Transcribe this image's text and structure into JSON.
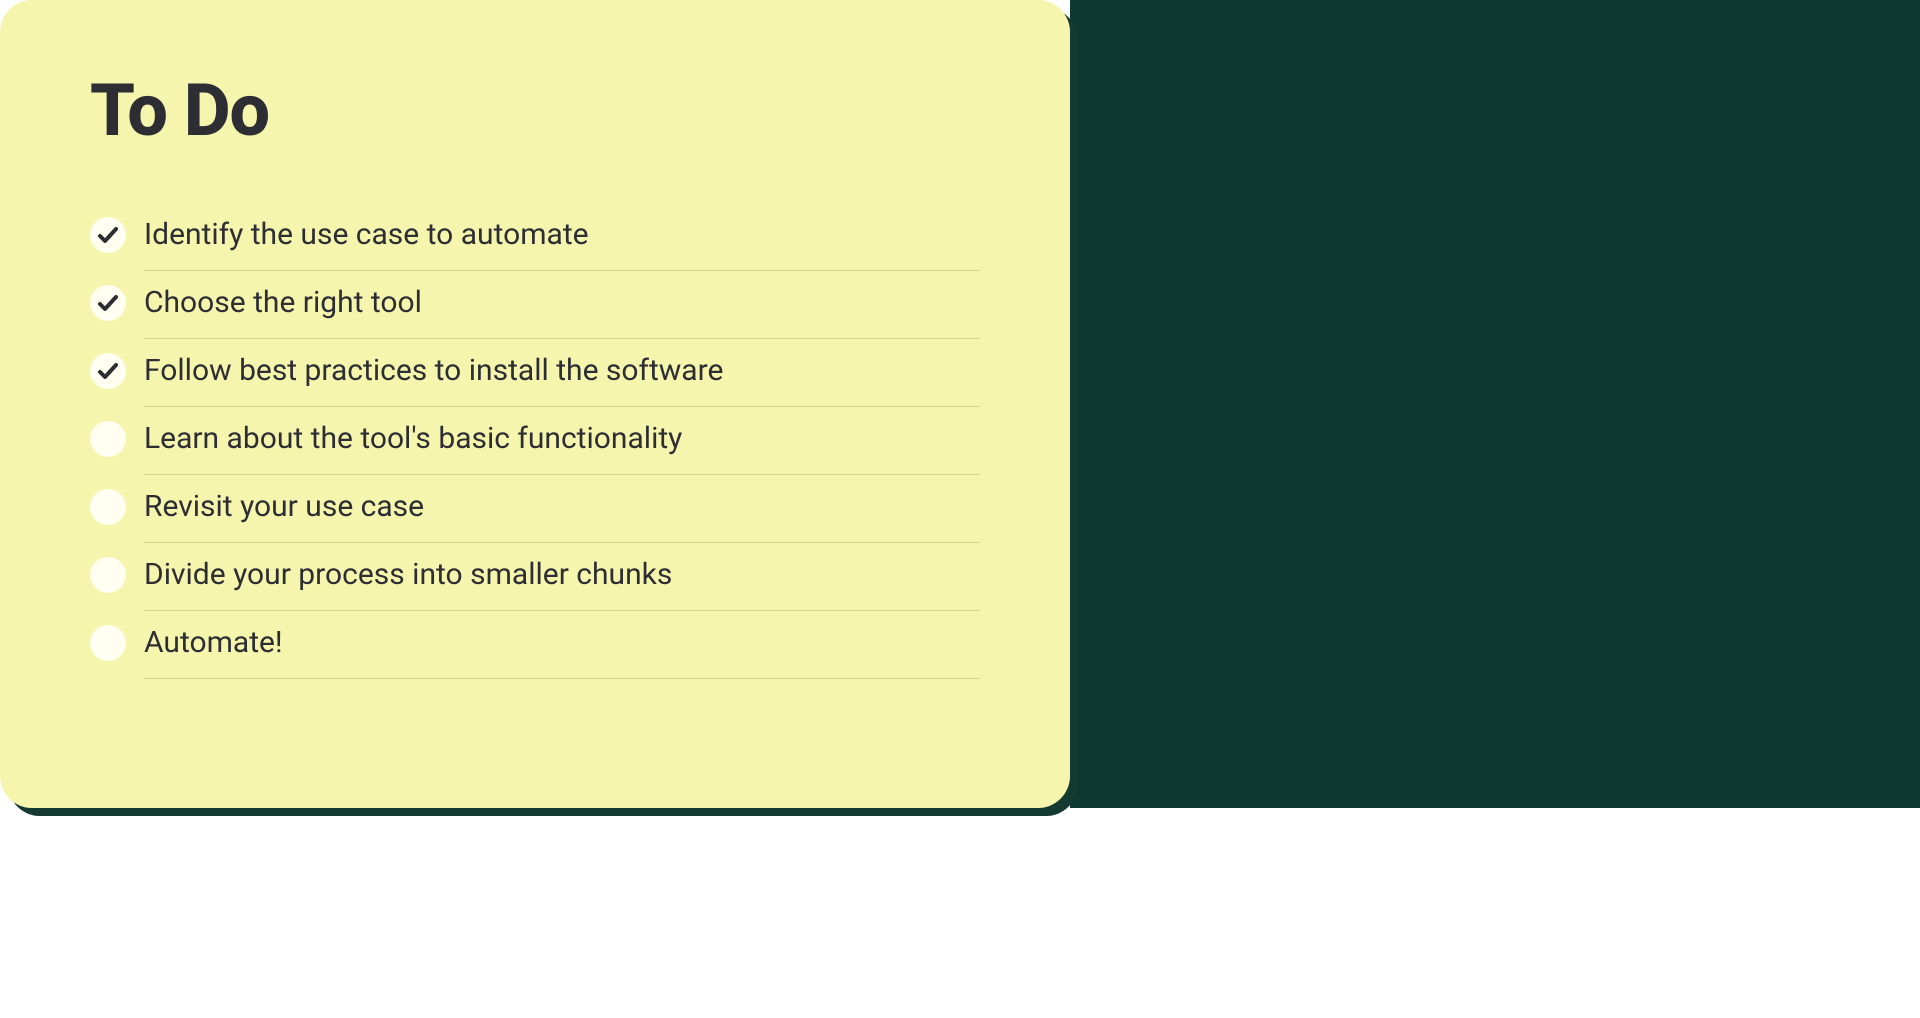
{
  "card": {
    "title": "To Do",
    "items": [
      {
        "label": "Identify the use case to automate",
        "checked": true
      },
      {
        "label": "Choose the right tool",
        "checked": true
      },
      {
        "label": "Follow best practices to install the software",
        "checked": true
      },
      {
        "label": "Learn about the tool's basic functionality",
        "checked": false
      },
      {
        "label": "Revisit your use case",
        "checked": false
      },
      {
        "label": "Divide your process into smaller chunks",
        "checked": false
      },
      {
        "label": "Automate!",
        "checked": false
      }
    ]
  }
}
